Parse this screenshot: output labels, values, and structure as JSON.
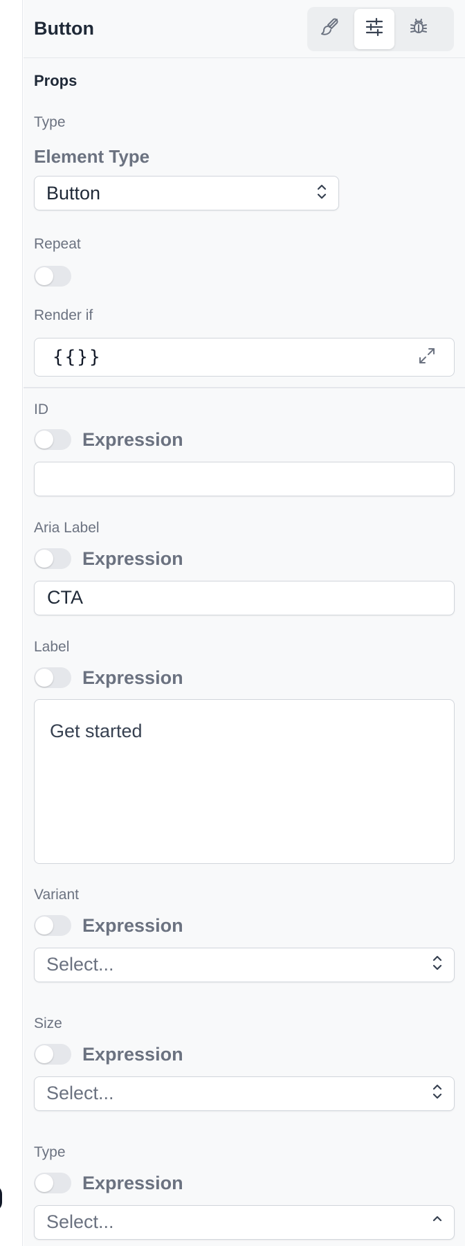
{
  "header": {
    "title": "Button",
    "tabs": [
      {
        "icon": "paintbrush-icon",
        "active": false
      },
      {
        "icon": "sliders-icon",
        "active": true
      },
      {
        "icon": "bug-icon",
        "active": false
      }
    ]
  },
  "props": {
    "section_title": "Props",
    "type_label": "Type",
    "element_type_label": "Element Type",
    "element_type_value": "Button",
    "repeat_label": "Repeat",
    "render_if_label": "Render if",
    "render_if_value": "{{}}"
  },
  "fields": {
    "id": {
      "label": "ID",
      "expression_label": "Expression",
      "value": ""
    },
    "aria_label": {
      "label": "Aria Label",
      "expression_label": "Expression",
      "value": "CTA"
    },
    "label": {
      "label": "Label",
      "expression_label": "Expression",
      "value": "Get started"
    },
    "variant": {
      "label": "Variant",
      "expression_label": "Expression",
      "placeholder": "Select..."
    },
    "size": {
      "label": "Size",
      "expression_label": "Expression",
      "placeholder": "Select..."
    },
    "type": {
      "label": "Type",
      "expression_label": "Expression",
      "placeholder": "Select..."
    }
  },
  "colors": {
    "panel_bg": "#f8f9fa",
    "border": "#d1d5db",
    "label_text": "#6b7280",
    "toggle_off": "#e5e7eb"
  }
}
